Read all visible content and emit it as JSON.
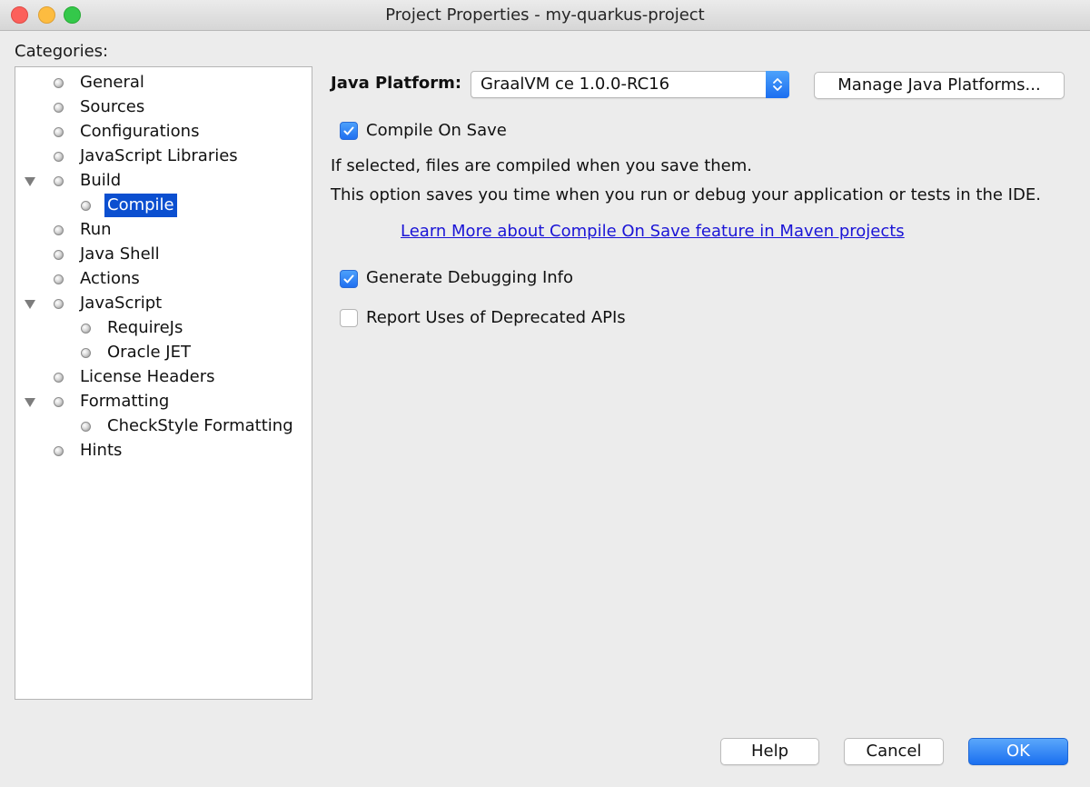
{
  "window": {
    "title": "Project Properties - my-quarkus-project"
  },
  "categories": {
    "label": "Categories:",
    "items": [
      {
        "label": "General"
      },
      {
        "label": "Sources"
      },
      {
        "label": "Configurations"
      },
      {
        "label": "JavaScript Libraries"
      },
      {
        "label": "Build",
        "expanded": true
      },
      {
        "label": "Compile",
        "selected": true
      },
      {
        "label": "Run"
      },
      {
        "label": "Java Shell"
      },
      {
        "label": "Actions"
      },
      {
        "label": "JavaScript",
        "expanded": true
      },
      {
        "label": "RequireJs"
      },
      {
        "label": "Oracle JET"
      },
      {
        "label": "License Headers"
      },
      {
        "label": "Formatting",
        "expanded": true
      },
      {
        "label": "CheckStyle Formatting"
      },
      {
        "label": "Hints"
      }
    ]
  },
  "compile": {
    "java_platform_label": "Java Platform:",
    "java_platform_value": "GraalVM ce 1.0.0-RC16",
    "manage_platforms_button": "Manage Java Platforms...",
    "compile_on_save": {
      "label": "Compile On Save",
      "checked": true
    },
    "description_1": "If selected, files are compiled when you save them.",
    "description_2": "This option saves you time when you run or debug your application or tests in the IDE.",
    "learn_more_link": "Learn More about Compile On Save feature in Maven projects",
    "generate_debugging_info": {
      "label": "Generate Debugging Info",
      "checked": true
    },
    "report_deprecated": {
      "label": "Report Uses of Deprecated APIs",
      "checked": false
    }
  },
  "footer": {
    "help": "Help",
    "cancel": "Cancel",
    "ok": "OK"
  },
  "colors": {
    "selection": "#0b4fd0",
    "accent": "#1f6ff0",
    "link": "#1a14d6"
  }
}
